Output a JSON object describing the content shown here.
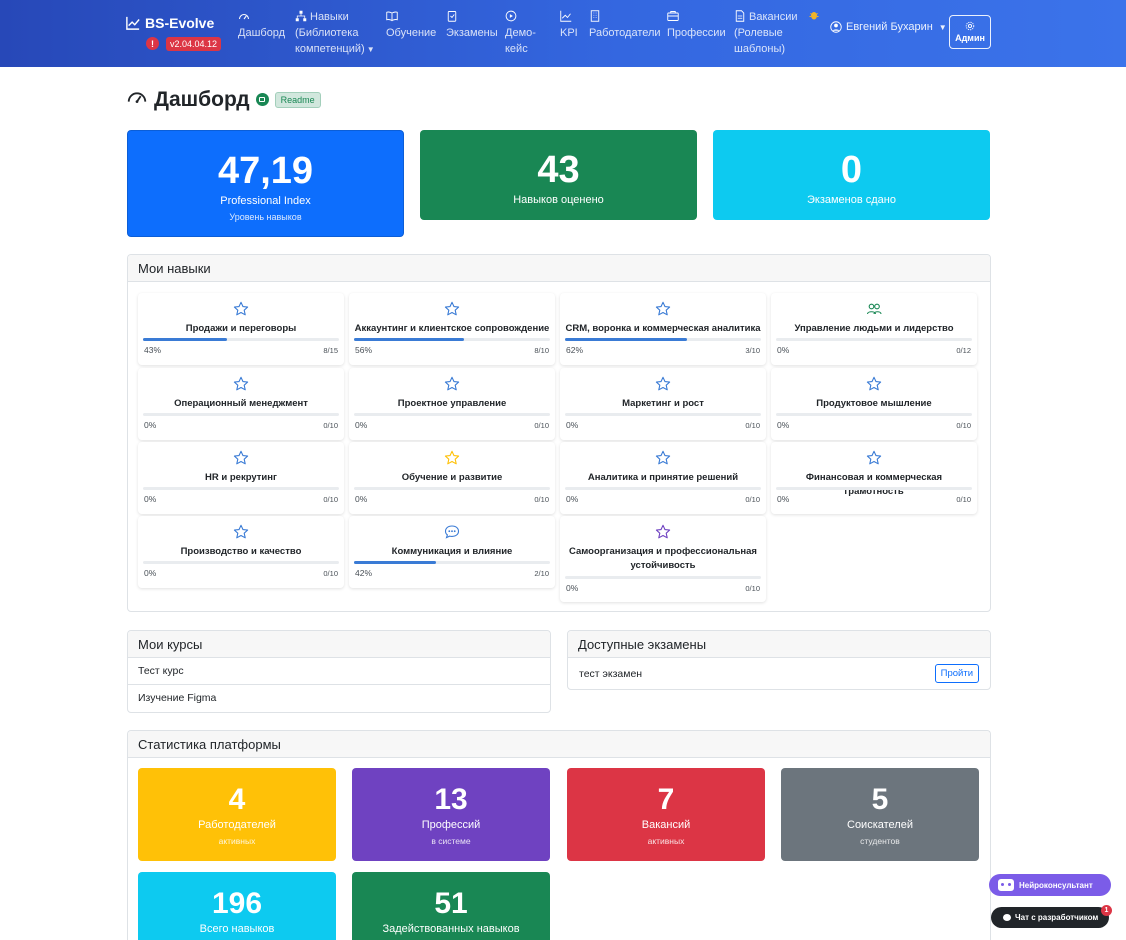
{
  "brand": {
    "name": "BS-Evolve",
    "alert": "!",
    "version": "v2.04.04.12"
  },
  "nav": [
    {
      "label": "Дашборд",
      "icon": "gauge-icon"
    },
    {
      "label": "Навыки (Библиотека компетенций)",
      "icon": "sitemap-icon"
    },
    {
      "label": "Обучение",
      "icon": "book-icon"
    },
    {
      "label": "Экзамены",
      "icon": "clipboard-icon"
    },
    {
      "label": "Демо-кейс",
      "icon": "play-circle-icon"
    },
    {
      "label": "KPI",
      "icon": "graph-icon"
    },
    {
      "label": "Работодатели",
      "icon": "building-icon"
    },
    {
      "label": "Профессии",
      "icon": "briefcase-icon"
    },
    {
      "label": "Вакансии (Ролевые шаблоны)",
      "icon": "document-icon"
    }
  ],
  "user": {
    "name": "Евгений Бухарин"
  },
  "admin_label": "Админ",
  "page": {
    "title": "Дашборд",
    "readme": "Readme"
  },
  "top_stats": [
    {
      "value": "47,19",
      "label": "Professional Index",
      "sub": "Уровень навыков",
      "color": "#0d6efd"
    },
    {
      "value": "43",
      "label": "Навыков оценено",
      "sub": "",
      "color": "#198754"
    },
    {
      "value": "0",
      "label": "Экзаменов сдано",
      "sub": "",
      "color": "#0dcaf0"
    }
  ],
  "skills_panel": {
    "title": "Мои навыки",
    "items": [
      {
        "name": "Продажи и переговоры",
        "percent": "43%",
        "count": "8/15",
        "progress": 0.43,
        "icon": "star-icon",
        "icon_color": "#3a7bd5"
      },
      {
        "name": "Аккаунтинг и клиентское сопровождение",
        "percent": "56%",
        "count": "8/10",
        "progress": 0.56,
        "icon": "star-icon",
        "icon_color": "#3a7bd5"
      },
      {
        "name": "CRM, воронка и коммерческая аналитика",
        "percent": "62%",
        "count": "3/10",
        "progress": 0.62,
        "icon": "star-icon",
        "icon_color": "#3a7bd5"
      },
      {
        "name": "Управление людьми и лидерство",
        "percent": "0%",
        "count": "0/12",
        "progress": 0,
        "icon": "people-icon",
        "icon_color": "#198754"
      },
      {
        "name": "Операционный менеджмент",
        "percent": "0%",
        "count": "0/10",
        "progress": 0,
        "icon": "star-icon",
        "icon_color": "#3a7bd5"
      },
      {
        "name": "Проектное управление",
        "percent": "0%",
        "count": "0/10",
        "progress": 0,
        "icon": "star-icon",
        "icon_color": "#3a7bd5"
      },
      {
        "name": "Маркетинг и рост",
        "percent": "0%",
        "count": "0/10",
        "progress": 0,
        "icon": "star-icon",
        "icon_color": "#3a7bd5"
      },
      {
        "name": "Продуктовое мышление",
        "percent": "0%",
        "count": "0/10",
        "progress": 0,
        "icon": "star-icon",
        "icon_color": "#3a7bd5"
      },
      {
        "name": "HR и рекрутинг",
        "percent": "0%",
        "count": "0/10",
        "progress": 0,
        "icon": "star-icon",
        "icon_color": "#3a7bd5"
      },
      {
        "name": "Обучение и развитие",
        "percent": "0%",
        "count": "0/10",
        "progress": 0,
        "icon": "star-icon",
        "icon_color": "#ffc107"
      },
      {
        "name": "Аналитика и принятие решений",
        "percent": "0%",
        "count": "0/10",
        "progress": 0,
        "icon": "star-icon",
        "icon_color": "#3a7bd5"
      },
      {
        "name": "Финансовая и коммерческая грамотность",
        "percent": "0%",
        "count": "0/10",
        "progress": 0,
        "icon": "star-icon",
        "icon_color": "#3a7bd5"
      },
      {
        "name": "Производство и качество",
        "percent": "0%",
        "count": "0/10",
        "progress": 0,
        "icon": "star-icon",
        "icon_color": "#3a7bd5"
      },
      {
        "name": "Коммуникация и влияние",
        "percent": "42%",
        "count": "2/10",
        "progress": 0.42,
        "icon": "chat-dots-icon",
        "icon_color": "#3a7bd5"
      },
      {
        "name": "Самоорганизация и профессиональная устойчивость",
        "percent": "0%",
        "count": "0/10",
        "progress": 0,
        "icon": "star-icon",
        "icon_color": "#6f42c1"
      }
    ]
  },
  "courses": {
    "title": "Мои курсы",
    "items": [
      "Тест курс",
      "Изучение Figma"
    ]
  },
  "exams": {
    "title": "Доступные экзамены",
    "items": [
      {
        "name": "тест экзамен",
        "action": "Пройти"
      }
    ]
  },
  "platform": {
    "title": "Статистика платформы",
    "cards": [
      {
        "value": "4",
        "label": "Работодателей",
        "sub": "активных",
        "color": "#ffc107"
      },
      {
        "value": "13",
        "label": "Профессий",
        "sub": "в системе",
        "color": "#6f42c1"
      },
      {
        "value": "7",
        "label": "Вакансий",
        "sub": "активных",
        "color": "#dc3545"
      },
      {
        "value": "5",
        "label": "Соискателей",
        "sub": "студентов",
        "color": "#6c757d"
      },
      {
        "value": "196",
        "label": "Всего навыков",
        "sub": "",
        "color": "#0dcaf0"
      },
      {
        "value": "51",
        "label": "Задействованных навыков",
        "sub": "",
        "color": "#198754"
      }
    ]
  },
  "floating": {
    "ai_label": "Нейроконсультант",
    "chat_label": "Чат с разработчиком",
    "chat_badge": "1"
  }
}
